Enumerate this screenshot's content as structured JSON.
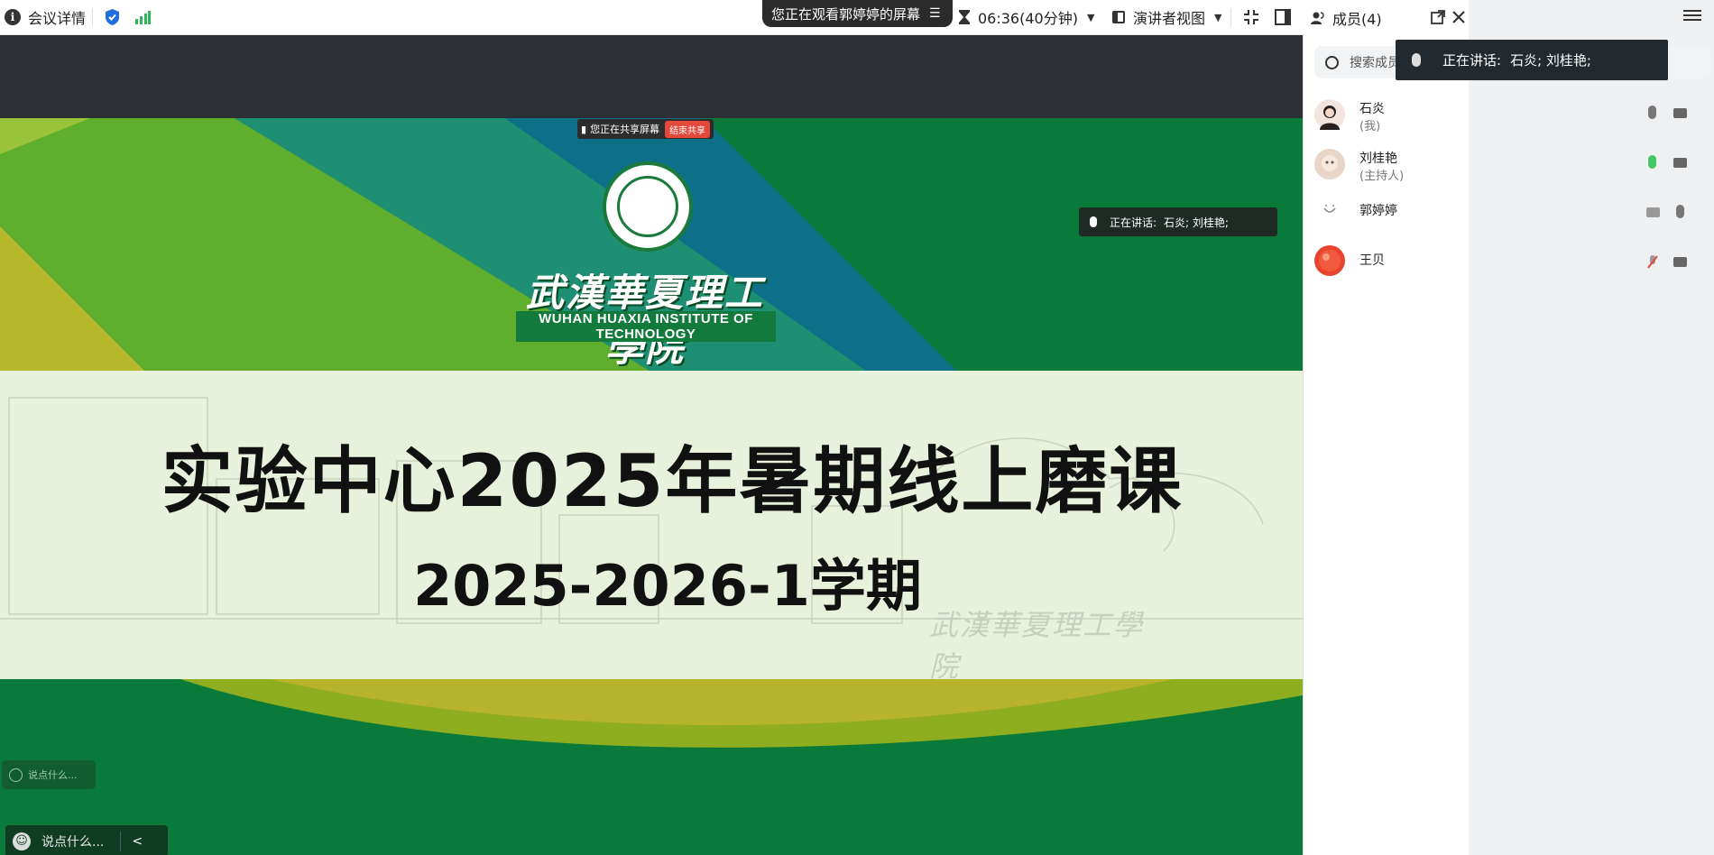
{
  "topbar": {
    "meeting_details": "会议详情",
    "watching_notice": "您正在观看郭婷婷的屏幕",
    "timer": "06:36(40分钟)",
    "view_mode": "演讲者视图",
    "members_tab": "成员(4)"
  },
  "speaking": {
    "label": "正在讲话:",
    "names": "石炎; 刘桂艳;"
  },
  "share": {
    "sharing_notice": "您正在共享屏幕",
    "stop_label": "结束共享"
  },
  "slide": {
    "school_name_cn": "武漢華夏理工學院",
    "school_name_en": "WUHAN HUAXIA INSTITUTE OF TECHNOLOGY",
    "title": "实验中心2025年暑期线上磨课",
    "subtitle": "2025-2026-1学期",
    "watermark": "武漢華夏理工學院"
  },
  "chat": {
    "placeholder": "说点什么..."
  },
  "members_panel": {
    "search_placeholder": "搜索成员",
    "members": [
      {
        "name": "石炎",
        "tag": "(我)"
      },
      {
        "name": "刘桂艳",
        "tag": "(主持人)"
      },
      {
        "name": "郭婷婷",
        "tag": ""
      },
      {
        "name": "王贝",
        "tag": ""
      }
    ]
  },
  "colors": {
    "slide_green": "#0a7a3a",
    "speaking_mic": "#44c767",
    "stop_share_red": "#e4483b"
  }
}
